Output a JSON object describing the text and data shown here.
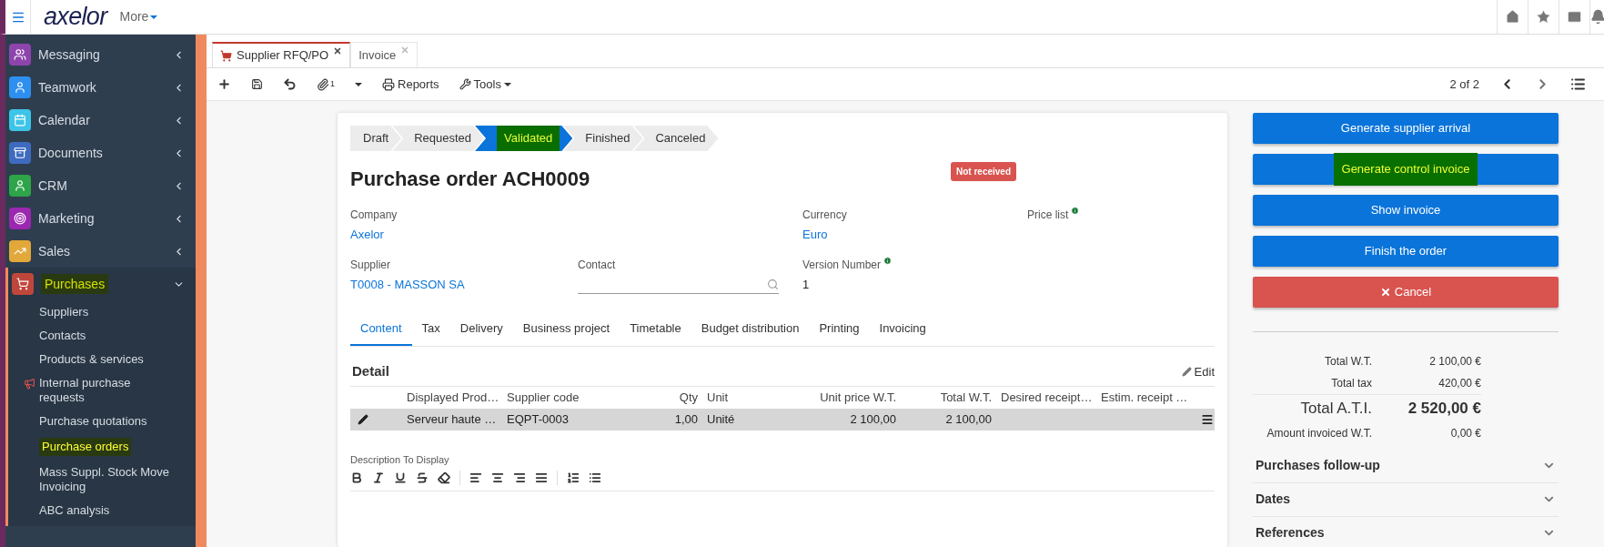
{
  "topbar": {
    "logo": "axelor",
    "more": "More"
  },
  "sidebar": {
    "items": [
      {
        "label": "Messaging",
        "color": "#8e44ad",
        "expanded": false,
        "highlighted": false
      },
      {
        "label": "Teamwork",
        "color": "#2d8ff0",
        "expanded": false,
        "highlighted": false
      },
      {
        "label": "Calendar",
        "color": "#3cc5e8",
        "expanded": false,
        "highlighted": false
      },
      {
        "label": "Documents",
        "color": "#3e6bbf",
        "expanded": false,
        "highlighted": false
      },
      {
        "label": "CRM",
        "color": "#2ea548",
        "expanded": false,
        "highlighted": false
      },
      {
        "label": "Marketing",
        "color": "#9c27b0",
        "expanded": false,
        "highlighted": false
      },
      {
        "label": "Sales",
        "color": "#e2a83a",
        "expanded": false,
        "highlighted": false
      },
      {
        "label": "Purchases",
        "color": "#c0463c",
        "expanded": true,
        "highlighted": true,
        "children": [
          {
            "label": "Suppliers",
            "highlighted": false,
            "alert": false
          },
          {
            "label": "Contacts",
            "highlighted": false,
            "alert": false
          },
          {
            "label": "Products & services",
            "highlighted": false,
            "alert": false
          },
          {
            "label": "Internal purchase requests",
            "highlighted": false,
            "alert": true
          },
          {
            "label": "Purchase quotations",
            "highlighted": false,
            "alert": false
          },
          {
            "label": "Purchase orders",
            "highlighted": true,
            "alert": false
          },
          {
            "label": "Mass Suppl. Stock Move Invoicing",
            "highlighted": false,
            "alert": false
          },
          {
            "label": "ABC analysis",
            "highlighted": false,
            "alert": false
          }
        ]
      }
    ]
  },
  "tabs": [
    {
      "label": "Supplier RFQ/PO",
      "selected": true
    },
    {
      "label": "Invoice",
      "selected": false
    }
  ],
  "toolbar": {
    "attachments": "1",
    "reports": "Reports",
    "tools": "Tools",
    "pager": "2 of 2"
  },
  "status_steps": [
    {
      "label": "Draft",
      "selected": false,
      "highlighted": false
    },
    {
      "label": "Requested",
      "selected": false,
      "highlighted": false
    },
    {
      "label": "Validated",
      "selected": true,
      "highlighted": true
    },
    {
      "label": "Finished",
      "selected": false,
      "highlighted": false
    },
    {
      "label": "Canceled",
      "selected": false,
      "highlighted": false
    }
  ],
  "form": {
    "title": "Purchase order ACH0009",
    "badge": "Not received",
    "company": {
      "label": "Company",
      "value": "Axelor"
    },
    "currency": {
      "label": "Currency",
      "value": "Euro"
    },
    "price_list": {
      "label": "Price list"
    },
    "supplier": {
      "label": "Supplier",
      "value": "T0008 - MASSON SA"
    },
    "contact": {
      "label": "Contact"
    },
    "version": {
      "label": "Version Number",
      "value": "1"
    }
  },
  "form_tabs": [
    {
      "label": "Content",
      "selected": true
    },
    {
      "label": "Tax",
      "selected": false
    },
    {
      "label": "Delivery",
      "selected": false
    },
    {
      "label": "Business project",
      "selected": false
    },
    {
      "label": "Timetable",
      "selected": false
    },
    {
      "label": "Budget distribution",
      "selected": false
    },
    {
      "label": "Printing",
      "selected": false
    },
    {
      "label": "Invoicing",
      "selected": false
    }
  ],
  "detail": {
    "title": "Detail",
    "edit": "Edit",
    "columns": [
      "Displayed Prod…",
      "Supplier code",
      "Qty",
      "Unit",
      "Unit price W.T.",
      "Total W.T.",
      "Desired receipt…",
      "Estim. receipt …"
    ],
    "rows": [
      {
        "selected": true,
        "cells": [
          "Serveur haute …",
          "EQPT-0003",
          "1,00",
          "Unité",
          "2 100,00",
          "2 100,00",
          "",
          ""
        ]
      }
    ]
  },
  "description": {
    "label": "Description To Display"
  },
  "actions": [
    {
      "label": "Generate supplier arrival",
      "kind": "primary",
      "highlighted": false
    },
    {
      "label": "Generate control invoice",
      "kind": "primary",
      "highlighted": true
    },
    {
      "label": "Show invoice",
      "kind": "primary",
      "highlighted": false
    },
    {
      "label": "Finish the order",
      "kind": "primary",
      "highlighted": false
    },
    {
      "label": "Cancel",
      "kind": "danger",
      "highlighted": false
    }
  ],
  "totals": [
    {
      "label": "Total W.T.",
      "value": "2 100,00 €",
      "kind": "normal"
    },
    {
      "label": "Total tax",
      "value": "420,00 €",
      "kind": "normal"
    },
    {
      "label": "Total A.T.I.",
      "value": "2 520,00 €",
      "kind": "grand"
    },
    {
      "label": "Amount invoiced W.T.",
      "value": "0,00 €",
      "kind": "normal"
    }
  ],
  "panels": [
    {
      "label": "Purchases follow-up",
      "expanded": false
    },
    {
      "label": "Dates",
      "expanded": false
    },
    {
      "label": "References",
      "expanded": false
    }
  ]
}
